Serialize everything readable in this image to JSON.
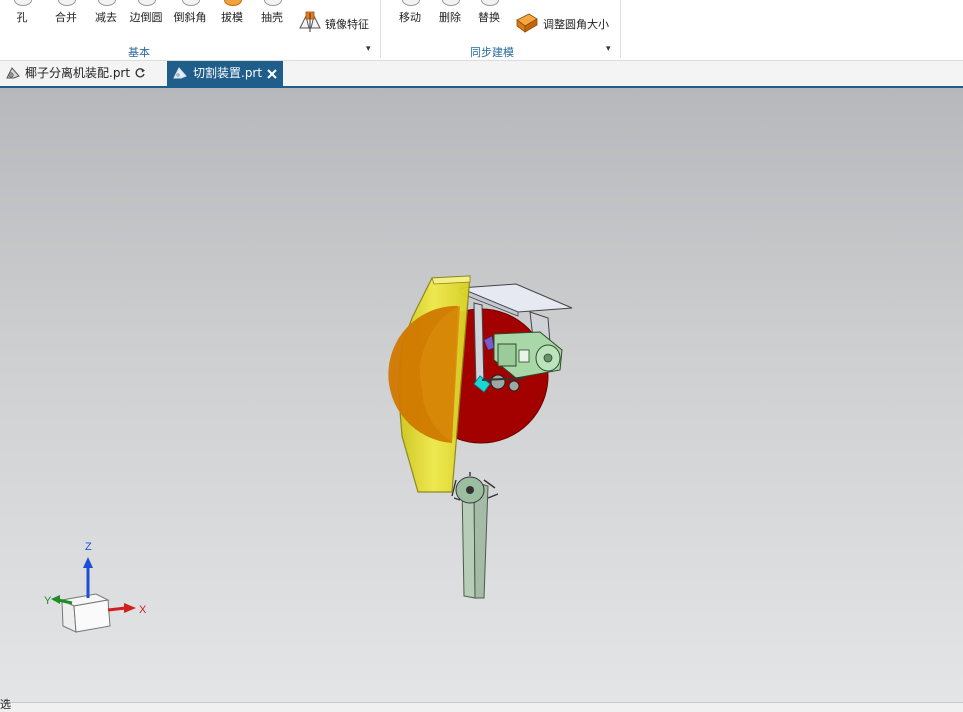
{
  "ribbon": {
    "basic_group": {
      "label": "基本",
      "buttons": [
        {
          "label": "孔"
        },
        {
          "label": "合并"
        },
        {
          "label": "减去"
        },
        {
          "label": "边倒圆"
        },
        {
          "label": "倒斜角"
        },
        {
          "label": "拔模"
        },
        {
          "label": "抽壳"
        }
      ],
      "mirror_feature": "镜像特征"
    },
    "sync_group": {
      "label": "同步建模",
      "buttons": [
        {
          "label": "移动"
        },
        {
          "label": "删除"
        },
        {
          "label": "替换"
        }
      ],
      "resize_blend": "调整圆角大小"
    },
    "expand_arrow": "▾"
  },
  "tabs": [
    {
      "label": "椰子分离机装配.prt",
      "active": false
    },
    {
      "label": "切割装置.prt",
      "active": true
    }
  ],
  "triad": {
    "x": "X",
    "y": "Y",
    "z": "Z"
  },
  "colors": {
    "accent": "#1f5d8a",
    "blade": "#a30000",
    "guard": "#e8e030",
    "motor": "#a9d7a8",
    "arm": "#b8d0b8"
  },
  "status": {
    "text": "选"
  }
}
